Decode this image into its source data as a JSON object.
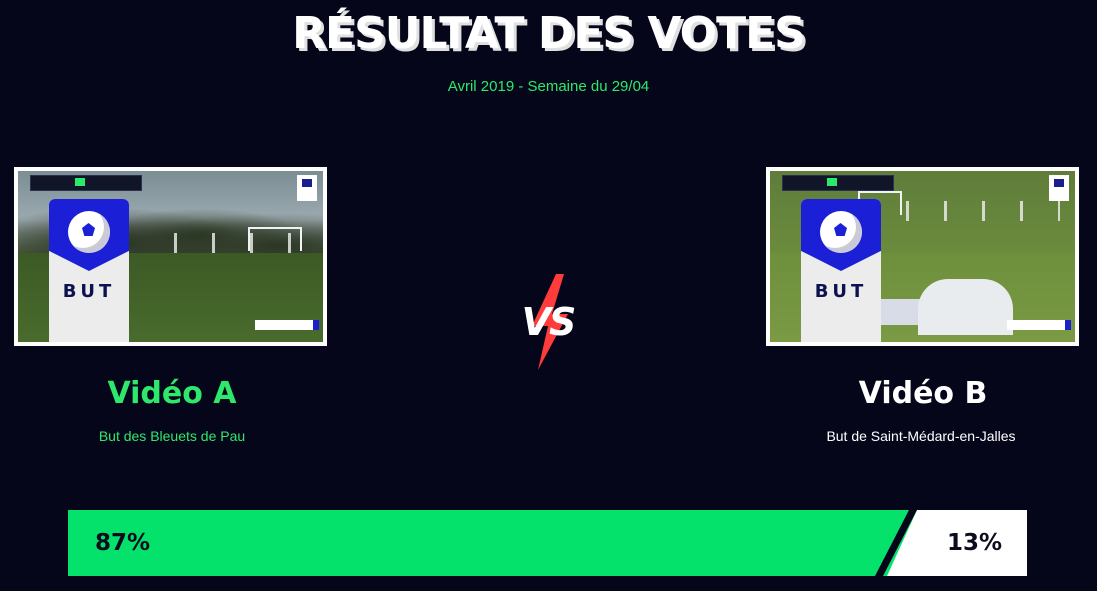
{
  "header": {
    "title": "RÉSULTAT DES VOTES",
    "subtitle": "Avril 2019 - Semaine du 29/04"
  },
  "video_a": {
    "title": "Vidéo A",
    "description": "But des Bleuets de Pau",
    "card_label": "BUT",
    "percent_label": "87%",
    "percent": 87
  },
  "video_b": {
    "title": "Vidéo B",
    "description": "But de Saint-Médard-en-Jalles",
    "card_label": "BUT",
    "percent_label": "13%",
    "percent": 13
  },
  "vs_label": "VS",
  "colors": {
    "background": "#05061a",
    "accent_green": "#05e26c",
    "text_green": "#2ee86b",
    "bolt_red": "#ff3b3b",
    "card_blue": "#1b20d6"
  }
}
